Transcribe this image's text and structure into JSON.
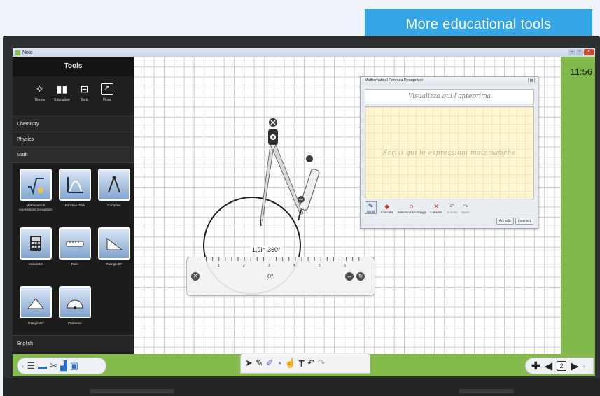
{
  "promo": {
    "label": "More educational tools"
  },
  "window": {
    "title": "Note",
    "minimize": "–",
    "restore": "▫",
    "close": "✕"
  },
  "clock": "11:56",
  "panel": {
    "title": "Tools",
    "tabs": [
      {
        "label": "Theme",
        "icon": "wand-icon"
      },
      {
        "label": "Education",
        "icon": "book-icon"
      },
      {
        "label": "Tools",
        "icon": "toolbox-icon"
      },
      {
        "label": "More",
        "icon": "arrow-out-icon"
      }
    ],
    "categories": {
      "chemistry": "Chemistry",
      "physics": "Physics",
      "math": "Math",
      "english": "English"
    },
    "items": [
      {
        "label": "Mathematical expressions recognition",
        "icon": "formula-icon"
      },
      {
        "label": "Function draw",
        "icon": "graph-icon"
      },
      {
        "label": "Compass",
        "icon": "compass-icon"
      },
      {
        "label": "Calculator",
        "icon": "calculator-icon"
      },
      {
        "label": "Ruler",
        "icon": "ruler-icon"
      },
      {
        "label": "Triangle30°",
        "icon": "triangle30-icon"
      },
      {
        "label": "Triangle45°",
        "icon": "triangle45-icon"
      },
      {
        "label": "Protractor",
        "icon": "protractor-icon"
      }
    ]
  },
  "dialog": {
    "title": "Mathematical Formula Recognizer",
    "close": "⊠",
    "preview_placeholder": "Visualizza qui l'anteprima",
    "writing_placeholder": "Scrivi qui le espressioni matematiche",
    "tools": {
      "write": "Scrivi",
      "erase": "Cancella",
      "select": "Seleziona e correggi",
      "clear": "Cancella",
      "undo": "Annulla",
      "redo": "Ripeti"
    },
    "cancel": "Annulla",
    "insert": "Inserisci"
  },
  "ruler": {
    "numbers": [
      "1",
      "2",
      "3",
      "4",
      "5",
      "6"
    ],
    "angle": "0°"
  },
  "compass": {
    "measure": "1,9in 360°"
  },
  "taskbar": {
    "page": "2"
  }
}
